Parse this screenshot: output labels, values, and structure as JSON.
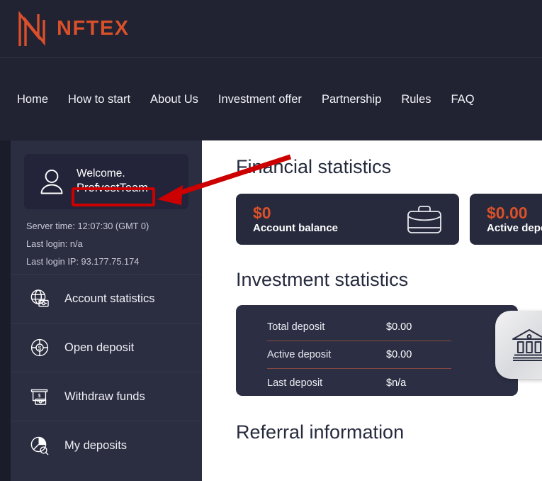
{
  "brand": {
    "logo_icon": "nftex-n-monogram-icon",
    "name": "NFTEX",
    "accent_color": "#d9502a"
  },
  "nav": {
    "items": [
      {
        "label": "Home",
        "name": "nav-home"
      },
      {
        "label": "How to start",
        "name": "nav-how-to-start"
      },
      {
        "label": "About Us",
        "name": "nav-about-us"
      },
      {
        "label": "Investment offer",
        "name": "nav-investment-offer"
      },
      {
        "label": "Partnership",
        "name": "nav-partnership"
      },
      {
        "label": "Rules",
        "name": "nav-rules"
      },
      {
        "label": "FAQ",
        "name": "nav-faq"
      }
    ]
  },
  "sidebar": {
    "user": {
      "avatar_icon": "user-avatar-icon",
      "welcome": "Welcome.",
      "username": "ProfvestTeam"
    },
    "meta": [
      "Server time: 12:07:30 (GMT 0)",
      "Last login: n/a",
      "Last login IP: 93.177.75.174"
    ],
    "server_time": "12:07:30 (GMT 0)",
    "last_login": "n/a",
    "last_login_ip": "93.177.75.174",
    "menu": [
      {
        "label": "Account statistics",
        "icon": "globe-card-icon"
      },
      {
        "label": "Open deposit",
        "icon": "target-dollar-icon"
      },
      {
        "label": "Withdraw funds",
        "icon": "atm-cash-icon"
      },
      {
        "label": "My deposits",
        "icon": "pie-chart-search-icon"
      }
    ]
  },
  "main": {
    "financial": {
      "title": "Financial statistics",
      "cards": [
        {
          "amount": "$0",
          "label": "Account balance",
          "icon": "briefcase-icon"
        },
        {
          "amount": "$0.00",
          "label": "Active deposit",
          "icon": ""
        }
      ]
    },
    "investment": {
      "title": "Investment statistics",
      "badge_icon": "bank-building-icon",
      "rows": [
        {
          "key": "Total deposit",
          "value": "$0.00"
        },
        {
          "key": "Active deposit",
          "value": "$0.00"
        },
        {
          "key": "Last deposit",
          "value": "$n/a"
        }
      ]
    },
    "referral": {
      "title": "Referral information"
    }
  },
  "annotation": {
    "highlight_color": "#cc0000",
    "highlight_target": "ProfvestTeam",
    "arrow": "red-arrow-pointing-to-username"
  }
}
